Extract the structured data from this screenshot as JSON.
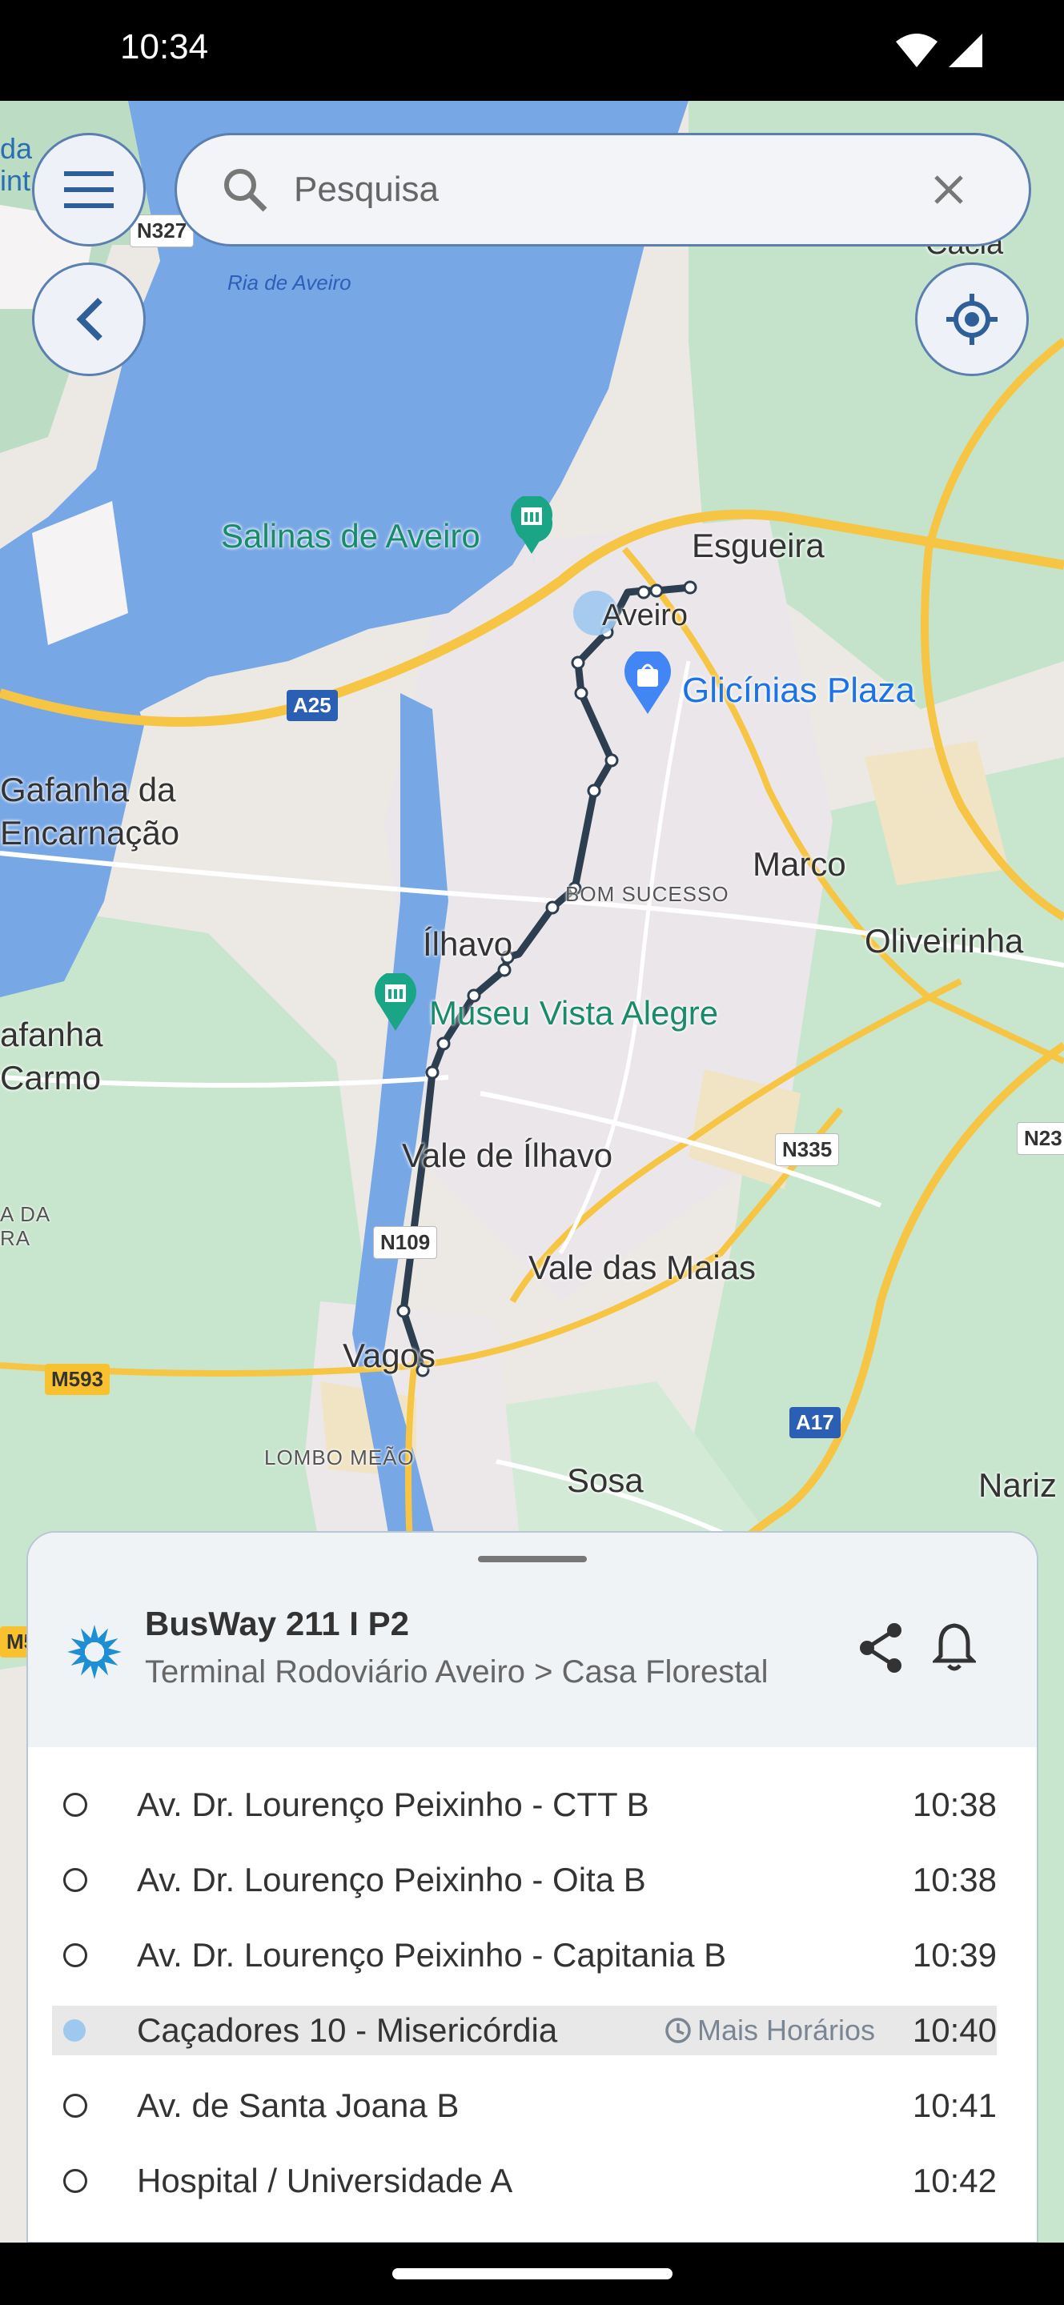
{
  "status_bar": {
    "time": "10:34"
  },
  "search": {
    "placeholder": "Pesquisa"
  },
  "map": {
    "places": {
      "salinas": "Salinas de Aveiro",
      "esgueira": "Esgueira",
      "aveiro": "Aveiro",
      "glicinias": "Glicínias Plaza",
      "gafanha_encarnacao": "Gafanha da\nEncarnação",
      "marco": "Marco",
      "bom_sucesso": "BOM SUCESSO",
      "oliveirinha": "Oliveirinha",
      "ilhavo": "Ílhavo",
      "museu": "Museu Vista Alegre",
      "gafanha_carmo": "afanha\nCarmo",
      "vale_ilhavo": "Vale de Ílhavo",
      "vale_maias": "Vale das Maias",
      "vagos": "Vagos",
      "lombo_meao": "LOMBO MEÃO",
      "sosa": "Sosa",
      "nariz": "Nariz",
      "ria_aveiro": "Ria de Aveiro",
      "da_ra": "A DA\nRA",
      "cacia": "Cacia",
      "top_left": "da\nint"
    },
    "roads": {
      "a25": "A25",
      "n327": "N327",
      "n335": "N335",
      "n23": "N23",
      "n109": "N109",
      "m593": "M593",
      "a17": "A17",
      "m5": "M5"
    }
  },
  "route": {
    "title": "BusWay 211 I P2",
    "subtitle": "Terminal Rodoviário Aveiro > Casa Florestal",
    "stops": [
      {
        "name": "Av. Dr. Lourenço Peixinho - CTT B",
        "time": "10:38"
      },
      {
        "name": "Av. Dr. Lourenço Peixinho - Oita B",
        "time": "10:38"
      },
      {
        "name": "Av. Dr. Lourenço Peixinho - Capitania B",
        "time": "10:39"
      },
      {
        "name": "Caçadores 10 - Misericórdia",
        "time": "10:40",
        "more_times": "Mais Horários"
      },
      {
        "name": "Av. de Santa Joana B",
        "time": "10:41"
      },
      {
        "name": "Hospital / Universidade A",
        "time": "10:42"
      }
    ]
  },
  "colors": {
    "route_line": "#2c3e50",
    "accent": "#1a73e8",
    "highlight_row": "#e8e8e8"
  },
  "icons": [
    "menu-icon",
    "search-icon",
    "clear-icon",
    "back-icon",
    "my-location-icon",
    "busway-logo-icon",
    "share-icon",
    "bell-icon",
    "clock-icon"
  ]
}
